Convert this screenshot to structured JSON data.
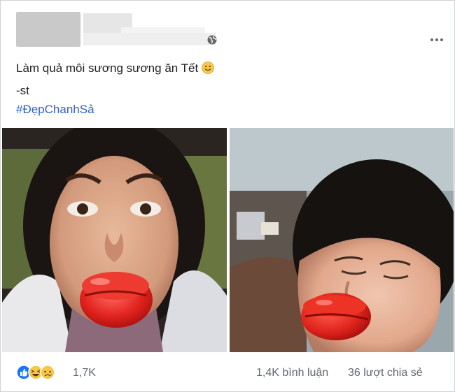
{
  "post": {
    "caption": "Làm quả môi sương sương ăn Tết",
    "emoji_icon": "smile-emoji",
    "credit": "-st",
    "hashtag": "#ĐẹpChanhSả"
  },
  "header": {
    "privacy_icon": "globe-icon",
    "menu_icon": "more-options-icon"
  },
  "photos": [
    {
      "name": "photo-left",
      "subject": "swollen-lips-selfie-1"
    },
    {
      "name": "photo-right",
      "subject": "swollen-lips-selfie-2"
    }
  ],
  "footer": {
    "reaction_icons": [
      "like-icon",
      "haha-icon",
      "sad-icon"
    ],
    "reaction_count": "1,7K",
    "comments": "1,4K bình luận",
    "shares": "36 lượt chia sẻ"
  },
  "colors": {
    "hashtag": "#2d63c8",
    "like": "#1877f2",
    "emoji": "#f7c64b"
  }
}
